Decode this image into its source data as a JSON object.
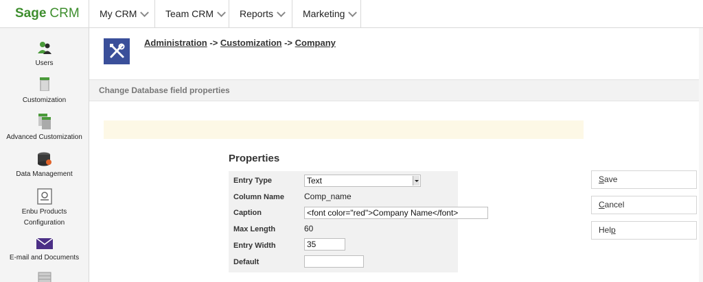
{
  "app": {
    "logo_bold": "Sage",
    "logo_rest": "CRM"
  },
  "nav": [
    {
      "label": "My CRM"
    },
    {
      "label": "Team CRM"
    },
    {
      "label": "Reports"
    },
    {
      "label": "Marketing"
    }
  ],
  "sidebar": {
    "items": [
      {
        "label": "Users",
        "icon": "users-icon"
      },
      {
        "label": "Customization",
        "icon": "customization-icon"
      },
      {
        "label": "Advanced Customization",
        "icon": "advanced-customization-icon"
      },
      {
        "label": "Data Management",
        "icon": "database-icon"
      },
      {
        "label_line1": "Enbu Products",
        "label_line2": "Configuration",
        "icon": "document-icon"
      },
      {
        "label": "E-mail and Documents",
        "icon": "envelope-icon"
      }
    ]
  },
  "breadcrumb": {
    "items": [
      "Administration",
      "Customization",
      "Company"
    ],
    "separator": "->"
  },
  "section": {
    "title": "Change Database field properties"
  },
  "properties": {
    "title": "Properties",
    "entry_type_label": "Entry Type",
    "entry_type_value": "Text",
    "column_name_label": "Column Name",
    "column_name_value": "Comp_name",
    "caption_label": "Caption",
    "caption_value": "<font color=\"red\">Company Name</font>",
    "max_length_label": "Max Length",
    "max_length_value": "60",
    "entry_width_label": "Entry Width",
    "entry_width_value": "35",
    "default_label": "Default",
    "default_value": ""
  },
  "actions": {
    "save_first": "S",
    "save_rest": "ave",
    "cancel_first": "C",
    "cancel_rest": "ancel",
    "help_pre": "Hel",
    "help_ul": "p"
  },
  "colors": {
    "brand": "#3e8e2e",
    "admin_icon": "#3a4f9a",
    "notice": "#fdf8e6"
  }
}
